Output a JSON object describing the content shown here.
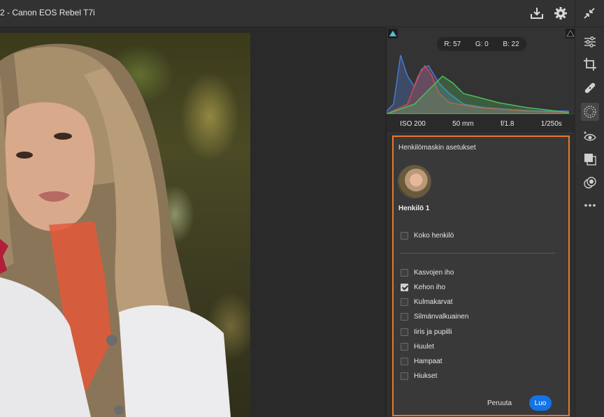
{
  "window": {
    "title": "2  -  Canon EOS Rebel T7i"
  },
  "histogram": {
    "readout": {
      "r": "R: 57",
      "g": "G: 0",
      "b": "B: 22"
    }
  },
  "exif": {
    "iso": "ISO 200",
    "focal": "50 mm",
    "aperture": "f/1.8",
    "shutter": "1/250s"
  },
  "mask_panel": {
    "title": "Henkilömaskin asetukset",
    "person_name": "Henkilö 1",
    "whole_person": {
      "label": "Koko henkilö",
      "checked": false
    },
    "parts": [
      {
        "label": "Kasvojen iho",
        "checked": false
      },
      {
        "label": "Kehon iho",
        "checked": true
      },
      {
        "label": "Kulmakarvat",
        "checked": false
      },
      {
        "label": "Silmänvalkuainen",
        "checked": false
      },
      {
        "label": "Iiris ja pupilli",
        "checked": false
      },
      {
        "label": "Huulet",
        "checked": false
      },
      {
        "label": "Hampaat",
        "checked": false
      },
      {
        "label": "Hiukset",
        "checked": false
      }
    ],
    "cancel_label": "Peruuta",
    "create_label": "Luo"
  },
  "colors": {
    "accent": "#1473e6",
    "highlight": "#e8782c"
  }
}
